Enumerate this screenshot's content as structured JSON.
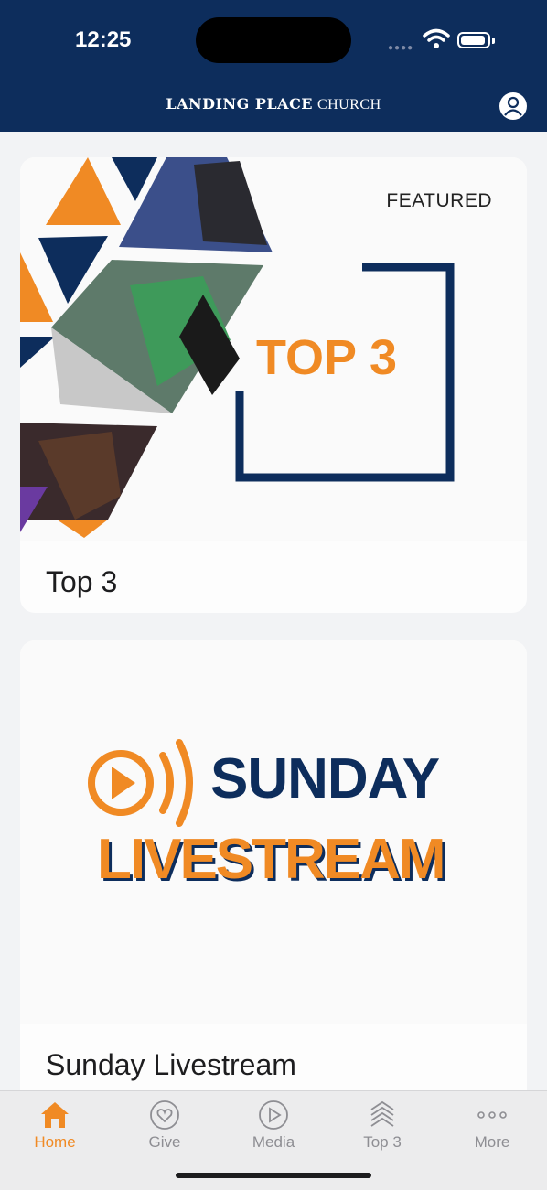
{
  "status": {
    "time": "12:25"
  },
  "header": {
    "brand_bold": "LANDING PLACE",
    "brand_light": "CHURCH"
  },
  "cards": [
    {
      "badge": "FEATURED",
      "art_text": "TOP 3",
      "title": "Top 3"
    },
    {
      "art_line1": "SUNDAY",
      "art_line2": "LIVESTREAM",
      "title": "Sunday Livestream"
    }
  ],
  "tabs": [
    {
      "label": "Home",
      "icon": "home-icon",
      "active": true
    },
    {
      "label": "Give",
      "icon": "heart-icon",
      "active": false
    },
    {
      "label": "Media",
      "icon": "play-icon",
      "active": false
    },
    {
      "label": "Top 3",
      "icon": "layers-icon",
      "active": false
    },
    {
      "label": "More",
      "icon": "more-icon",
      "active": false
    }
  ],
  "colors": {
    "navy": "#0d2d5c",
    "orange": "#f08a24",
    "tab_inactive": "#8e8e93"
  }
}
